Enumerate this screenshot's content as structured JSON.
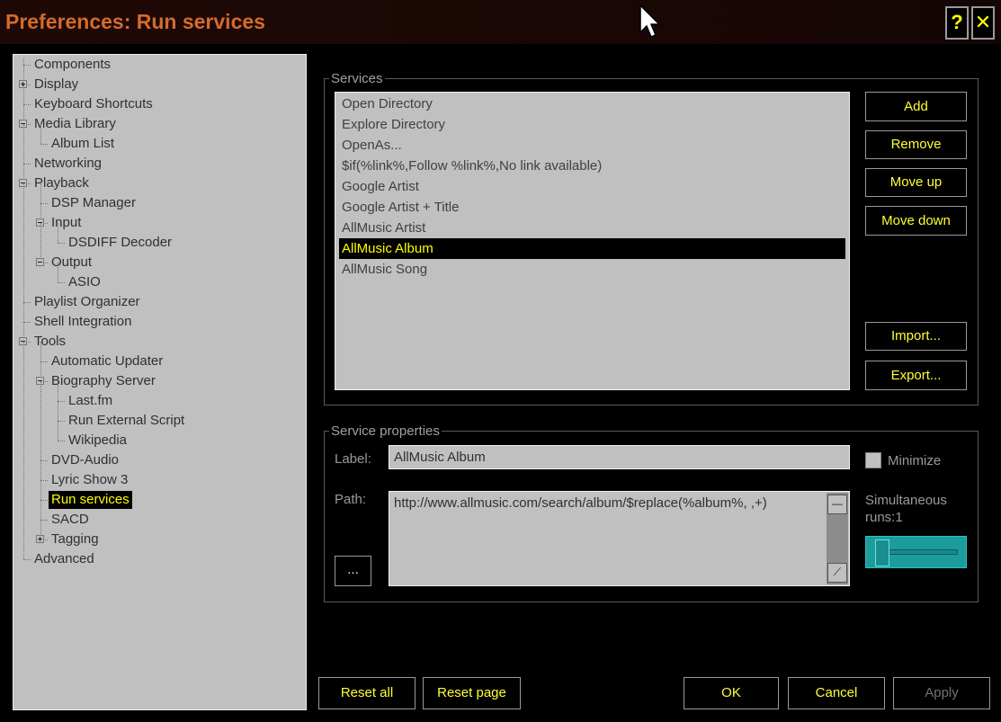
{
  "window": {
    "title": "Preferences: Run services",
    "help_label": "?",
    "close_label": "✕"
  },
  "tree": [
    {
      "label": "Components",
      "depth": 0
    },
    {
      "label": "Display",
      "depth": 0,
      "expander": "plus"
    },
    {
      "label": "Keyboard Shortcuts",
      "depth": 0
    },
    {
      "label": "Media Library",
      "depth": 0,
      "expander": "minus"
    },
    {
      "label": "Album List",
      "depth": 1
    },
    {
      "label": "Networking",
      "depth": 0
    },
    {
      "label": "Playback",
      "depth": 0,
      "expander": "minus"
    },
    {
      "label": "DSP Manager",
      "depth": 1
    },
    {
      "label": "Input",
      "depth": 1,
      "expander": "minus"
    },
    {
      "label": "DSDIFF Decoder",
      "depth": 2
    },
    {
      "label": "Output",
      "depth": 1,
      "expander": "minus"
    },
    {
      "label": "ASIO",
      "depth": 2
    },
    {
      "label": "Playlist Organizer",
      "depth": 0
    },
    {
      "label": "Shell Integration",
      "depth": 0
    },
    {
      "label": "Tools",
      "depth": 0,
      "expander": "minus"
    },
    {
      "label": "Automatic Updater",
      "depth": 1
    },
    {
      "label": "Biography Server",
      "depth": 1,
      "expander": "minus"
    },
    {
      "label": "Last.fm",
      "depth": 2
    },
    {
      "label": "Run External Script",
      "depth": 2
    },
    {
      "label": "Wikipedia",
      "depth": 2
    },
    {
      "label": "DVD-Audio",
      "depth": 1
    },
    {
      "label": "Lyric Show 3",
      "depth": 1
    },
    {
      "label": "Run services",
      "depth": 1,
      "selected": true
    },
    {
      "label": "SACD",
      "depth": 1
    },
    {
      "label": "Tagging",
      "depth": 1,
      "expander": "plus"
    },
    {
      "label": "Advanced",
      "depth": 0
    }
  ],
  "services": {
    "group_label": "Services",
    "items": [
      {
        "label": "Open Directory"
      },
      {
        "label": "Explore Directory"
      },
      {
        "label": "OpenAs..."
      },
      {
        "label": "$if(%link%,Follow %link%,No link available)"
      },
      {
        "label": "Google Artist"
      },
      {
        "label": "Google Artist + Title"
      },
      {
        "label": "AllMusic Artist"
      },
      {
        "label": "AllMusic Album",
        "selected": true
      },
      {
        "label": "AllMusic Song"
      }
    ],
    "buttons": {
      "add": "Add",
      "remove": "Remove",
      "move_up": "Move up",
      "move_down": "Move down",
      "import": "Import...",
      "export": "Export..."
    }
  },
  "properties": {
    "group_label": "Service properties",
    "label_caption": "Label:",
    "label_value": "AllMusic Album",
    "minimize_label": "Minimize",
    "path_caption": "Path:",
    "path_value": "http://www.allmusic.com/search/album/$replace(%album%, ,+)",
    "browse_label": "...",
    "simultaneous_label": "Simultaneous runs:1",
    "simultaneous_value": 1
  },
  "footer": {
    "reset_all": "Reset all",
    "reset_page": "Reset page",
    "ok": "OK",
    "cancel": "Cancel",
    "apply": "Apply"
  },
  "colors": {
    "accent_text": "#ffff33",
    "title_text": "#d36b2c",
    "panel_bg": "#c0c0c0",
    "slider_bg": "#1d9c9c"
  }
}
